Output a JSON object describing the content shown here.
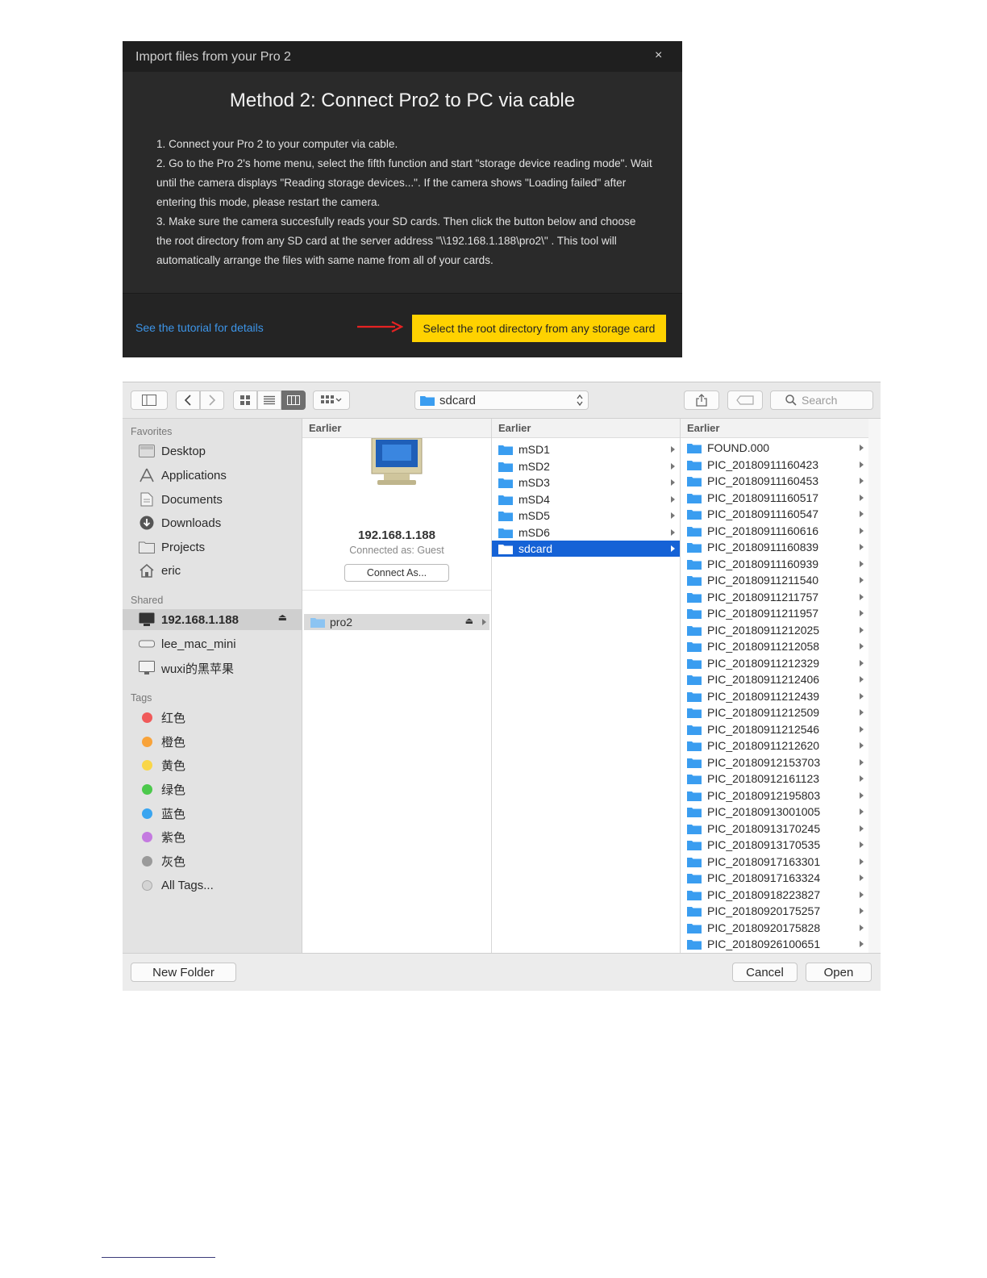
{
  "import_dialog": {
    "title": "Import files from your Pro 2",
    "close": "×",
    "heading": "Method 2: Connect Pro2 to PC via cable",
    "steps": [
      "1. Connect your Pro 2 to your computer via cable.",
      "2. Go to the Pro 2's home menu, select the fifth function and start \"storage device reading mode\". Wait until the camera displays \"Reading storage devices...\". If the camera shows \"Loading failed\" after entering this mode, please restart the camera.",
      "3. Make sure the camera succesfully reads your SD cards. Then click the button below and choose the root directory from any SD card at the server address \"\\\\192.168.1.188\\pro2\\\" . This tool will automatically arrange the files with same name from all of your cards."
    ],
    "tutorial_link": "See the tutorial for details",
    "select_button": "Select the root directory from any storage card",
    "accent_color": "#ffd200"
  },
  "finder": {
    "path_popup": "sdcard",
    "search_placeholder": "Search",
    "sidebar": {
      "favorites_heading": "Favorites",
      "favorites": [
        "Desktop",
        "Applications",
        "Documents",
        "Downloads",
        "Projects",
        "eric"
      ],
      "shared_heading": "Shared",
      "shared": [
        "192.168.1.188",
        "lee_mac_mini",
        "wuxi的黑苹果"
      ],
      "tags_heading": "Tags",
      "tags": [
        {
          "label": "红色",
          "color": "#f05a5a"
        },
        {
          "label": "橙色",
          "color": "#f8a33a"
        },
        {
          "label": "黄色",
          "color": "#f9d648"
        },
        {
          "label": "绿色",
          "color": "#4cc94c"
        },
        {
          "label": "蓝色",
          "color": "#3aa5f0"
        },
        {
          "label": "紫色",
          "color": "#c47ae0"
        },
        {
          "label": "灰色",
          "color": "#9a9a9a"
        },
        {
          "label": "All Tags...",
          "color": "#d4d4d4"
        }
      ]
    },
    "columns": {
      "col1": {
        "header": "Earlier",
        "server_name": "192.168.1.188",
        "connected_as": "Connected as: Guest",
        "connect_button": "Connect As...",
        "share": "pro2"
      },
      "col2": {
        "header": "Earlier",
        "items": [
          "mSD1",
          "mSD2",
          "mSD3",
          "mSD4",
          "mSD5",
          "mSD6",
          "sdcard"
        ],
        "selected": "sdcard"
      },
      "col3": {
        "header": "Earlier",
        "items": [
          "FOUND.000",
          "PIC_20180911160423",
          "PIC_20180911160453",
          "PIC_20180911160517",
          "PIC_20180911160547",
          "PIC_20180911160616",
          "PIC_20180911160839",
          "PIC_20180911160939",
          "PIC_20180911211540",
          "PIC_20180911211757",
          "PIC_20180911211957",
          "PIC_20180911212025",
          "PIC_20180911212058",
          "PIC_20180911212329",
          "PIC_20180911212406",
          "PIC_20180911212439",
          "PIC_20180911212509",
          "PIC_20180911212546",
          "PIC_20180911212620",
          "PIC_20180912153703",
          "PIC_20180912161123",
          "PIC_20180912195803",
          "PIC_20180913001005",
          "PIC_20180913170245",
          "PIC_20180913170535",
          "PIC_20180917163301",
          "PIC_20180917163324",
          "PIC_20180918223827",
          "PIC_20180920175257",
          "PIC_20180920175828",
          "PIC_20180926100651"
        ]
      }
    },
    "buttons": {
      "new_folder": "New Folder",
      "cancel": "Cancel",
      "open": "Open"
    },
    "selection_color": "#1562d6",
    "folder_color": "#3a9df0"
  }
}
